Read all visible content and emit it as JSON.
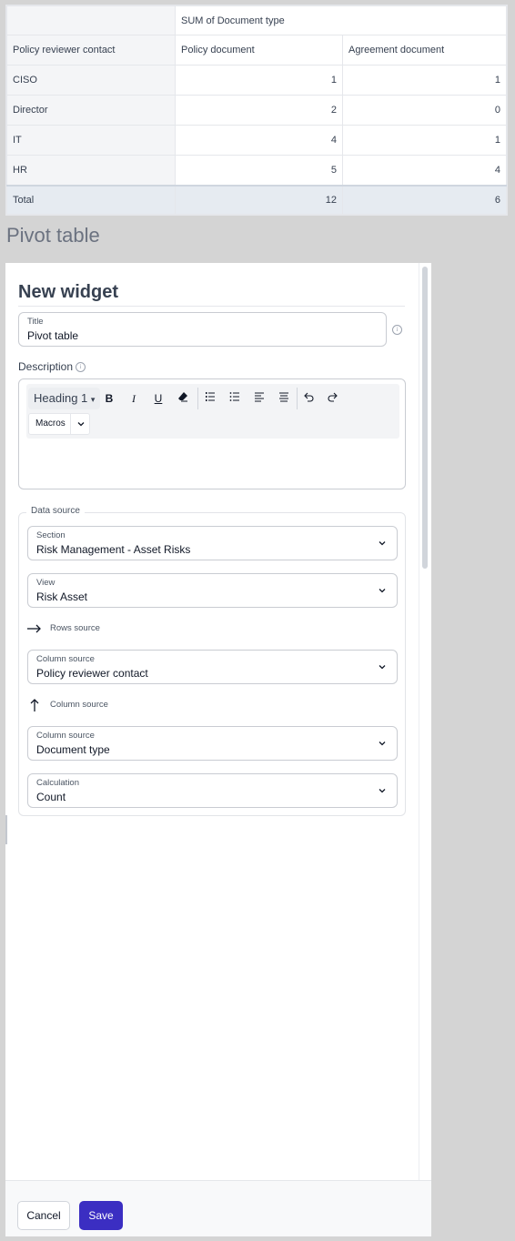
{
  "pivot": {
    "group_header": "SUM of Document type",
    "row_header": "Policy reviewer contact",
    "columns": [
      "Policy document",
      "Agreement document"
    ],
    "rows": [
      {
        "label": "CISO",
        "values": [
          "1",
          "1"
        ]
      },
      {
        "label": "Director",
        "values": [
          "2",
          "0"
        ]
      },
      {
        "label": "IT",
        "values": [
          "4",
          "1"
        ]
      },
      {
        "label": "HR",
        "values": [
          "5",
          "4"
        ]
      }
    ],
    "total": {
      "label": "Total",
      "values": [
        "12",
        "6"
      ]
    }
  },
  "widget_caption": "Pivot table",
  "panel": {
    "heading": "New widget",
    "title_field": {
      "label": "Title",
      "value": "Pivot table"
    },
    "description_label": "Description",
    "toolbar": {
      "heading_select": "Heading 1",
      "bold": "B",
      "italic": "I",
      "underline": "U",
      "macros": "Macros"
    },
    "data_source": {
      "legend": "Data source",
      "section": {
        "label": "Section",
        "value": "Risk Management - Asset Risks"
      },
      "view": {
        "label": "View",
        "value": "Risk Asset"
      },
      "rows_source_label": "Rows source",
      "rows_column": {
        "label": "Column source",
        "value": "Policy reviewer contact"
      },
      "column_source_label": "Column source",
      "columns_column": {
        "label": "Column source",
        "value": "Document type"
      },
      "calculation": {
        "label": "Calculation",
        "value": "Count"
      }
    },
    "footer": {
      "cancel": "Cancel",
      "save": "Save"
    }
  },
  "colors": {
    "primary": "#3b2ec2",
    "total_row": "#e6ebf1",
    "label_col": "#f4f5f7"
  }
}
